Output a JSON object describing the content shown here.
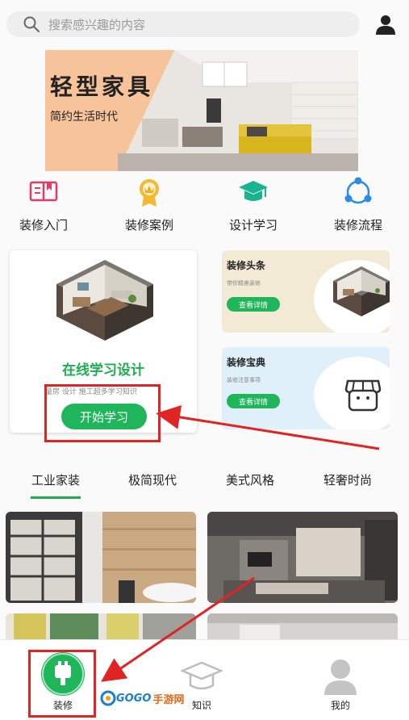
{
  "search": {
    "placeholder": "搜索感兴趣的内容"
  },
  "banner": {
    "title": "轻型家具",
    "subtitle": "简约生活时代"
  },
  "categories": [
    {
      "label": "装修入门",
      "icon": "book-icon"
    },
    {
      "label": "装修案例",
      "icon": "medal-icon"
    },
    {
      "label": "设计学习",
      "icon": "graduation-cap-icon"
    },
    {
      "label": "装修流程",
      "icon": "cycle-icon"
    }
  ],
  "main_card": {
    "title": "在线学习设计",
    "subtitle": "量房 设计 施工超多学习知识",
    "button": "开始学习"
  },
  "side_cards": [
    {
      "title": "装修头条",
      "desc": "带你精美装修",
      "button": "查看详情"
    },
    {
      "title": "装修宝典",
      "desc": "装修注意事项",
      "button": "查看详情"
    }
  ],
  "tabs": [
    "工业家装",
    "极简现代",
    "美式风格",
    "轻奢时尚"
  ],
  "active_tab": 0,
  "bottom_nav": [
    {
      "label": "装修",
      "icon": "plug-icon",
      "active": true
    },
    {
      "label": "知识",
      "icon": "graduation-cap-icon"
    },
    {
      "label": "我的",
      "icon": "user-icon"
    }
  ],
  "watermark": {
    "latin": "GOGO",
    "cn": "手游网"
  },
  "colors": {
    "accent": "#1fae4e",
    "annotation": "#e02424"
  }
}
